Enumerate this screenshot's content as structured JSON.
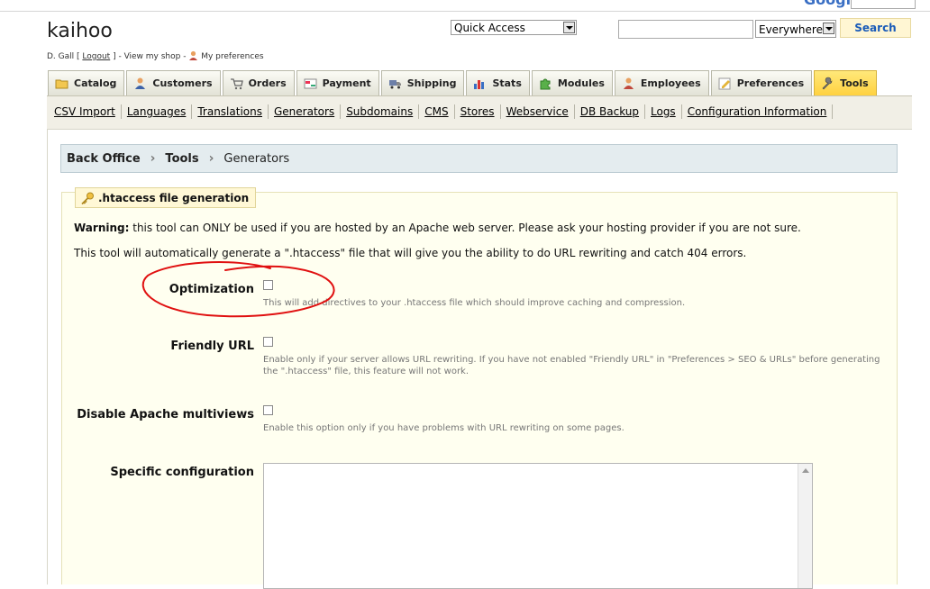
{
  "header": {
    "shop_name": "kaihoo",
    "user_name": "D. Gall",
    "logout_label": "Logout",
    "view_shop_label": "View my shop",
    "preferences_label": "My preferences",
    "quick_access": "Quick Access",
    "search_value": "",
    "search_scope": "Everywhere",
    "search_button": "Search"
  },
  "tabs": [
    {
      "label": "Catalog",
      "icon": "folder-icon"
    },
    {
      "label": "Customers",
      "icon": "customer-icon"
    },
    {
      "label": "Orders",
      "icon": "cart-icon"
    },
    {
      "label": "Payment",
      "icon": "payment-icon"
    },
    {
      "label": "Shipping",
      "icon": "truck-icon"
    },
    {
      "label": "Stats",
      "icon": "chart-icon"
    },
    {
      "label": "Modules",
      "icon": "puzzle-icon"
    },
    {
      "label": "Employees",
      "icon": "employee-icon"
    },
    {
      "label": "Preferences",
      "icon": "preferences-icon"
    },
    {
      "label": "Tools",
      "icon": "wrench-icon"
    }
  ],
  "active_tab": "Tools",
  "subnav": [
    "CSV Import",
    "Languages",
    "Translations",
    "Generators",
    "Subdomains",
    "CMS",
    "Stores",
    "Webservice",
    "DB Backup",
    "Logs",
    "Configuration Information"
  ],
  "breadcrumb": [
    "Back Office",
    "Tools",
    "Generators"
  ],
  "section": {
    "legend": ".htaccess file generation",
    "warning_label": "Warning:",
    "warning_text": " this tool can ONLY be used if you are hosted by an Apache web server. Please ask your hosting provider if you are not sure.",
    "description": "This tool will automatically generate a \".htaccess\" file that will give you the ability to do URL rewriting and catch 404 errors.",
    "fields": [
      {
        "label": "Optimization",
        "hint": "This will add directives to your .htaccess file which should improve caching and compression."
      },
      {
        "label": "Friendly URL",
        "hint": "Enable only if your server allows URL rewriting. If you have not enabled \"Friendly URL\" in \"Preferences > SEO & URLs\" before generating the \".htaccess\" file, this feature will not work."
      },
      {
        "label": "Disable Apache multiviews",
        "hint": "Enable this option only if you have problems with URL rewriting on some pages."
      }
    ],
    "specific_label": "Specific configuration",
    "specific_value": ""
  },
  "annotation_color": "#e01010"
}
